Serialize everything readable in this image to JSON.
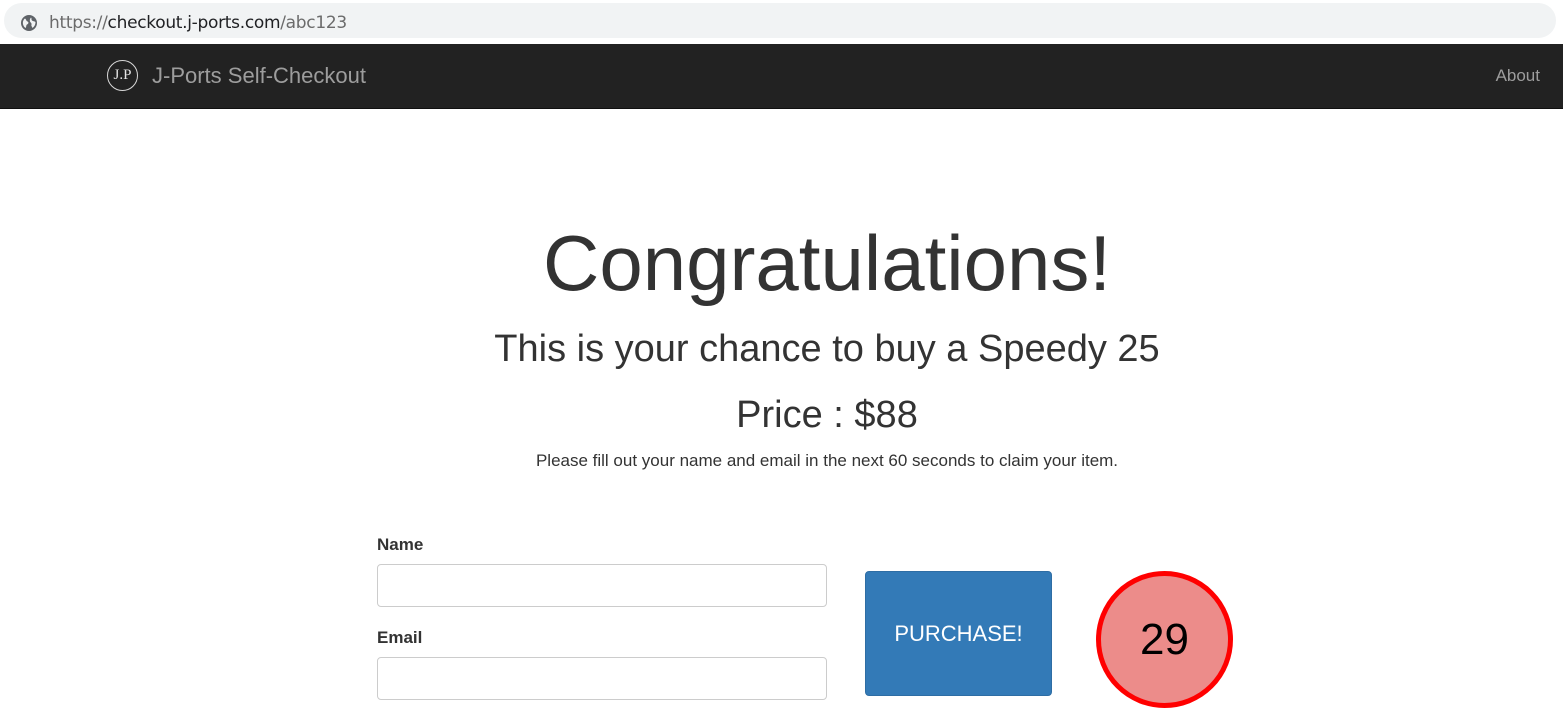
{
  "browser": {
    "url_scheme": "https://",
    "url_host": "checkout.j-ports.com",
    "url_path": "/abc123",
    "icon": "globe-icon"
  },
  "navbar": {
    "brand_logo_text": "J.P",
    "brand_name": "J-Ports Self-Checkout",
    "about_label": "About"
  },
  "main": {
    "heading": "Congratulations!",
    "subheading": "This is your chance to buy a Speedy 25",
    "price": "Price : $88",
    "instructions": "Please fill out your name and email in the next 60 seconds to claim your item."
  },
  "form": {
    "name_label": "Name",
    "name_value": "",
    "email_label": "Email",
    "email_value": "",
    "purchase_label": "PURCHASE!"
  },
  "countdown": {
    "value": "29"
  },
  "colors": {
    "navbar_bg": "#222222",
    "button_primary": "#337ab7",
    "countdown_border": "#ff0000",
    "countdown_fill": "#ec8c8a"
  }
}
